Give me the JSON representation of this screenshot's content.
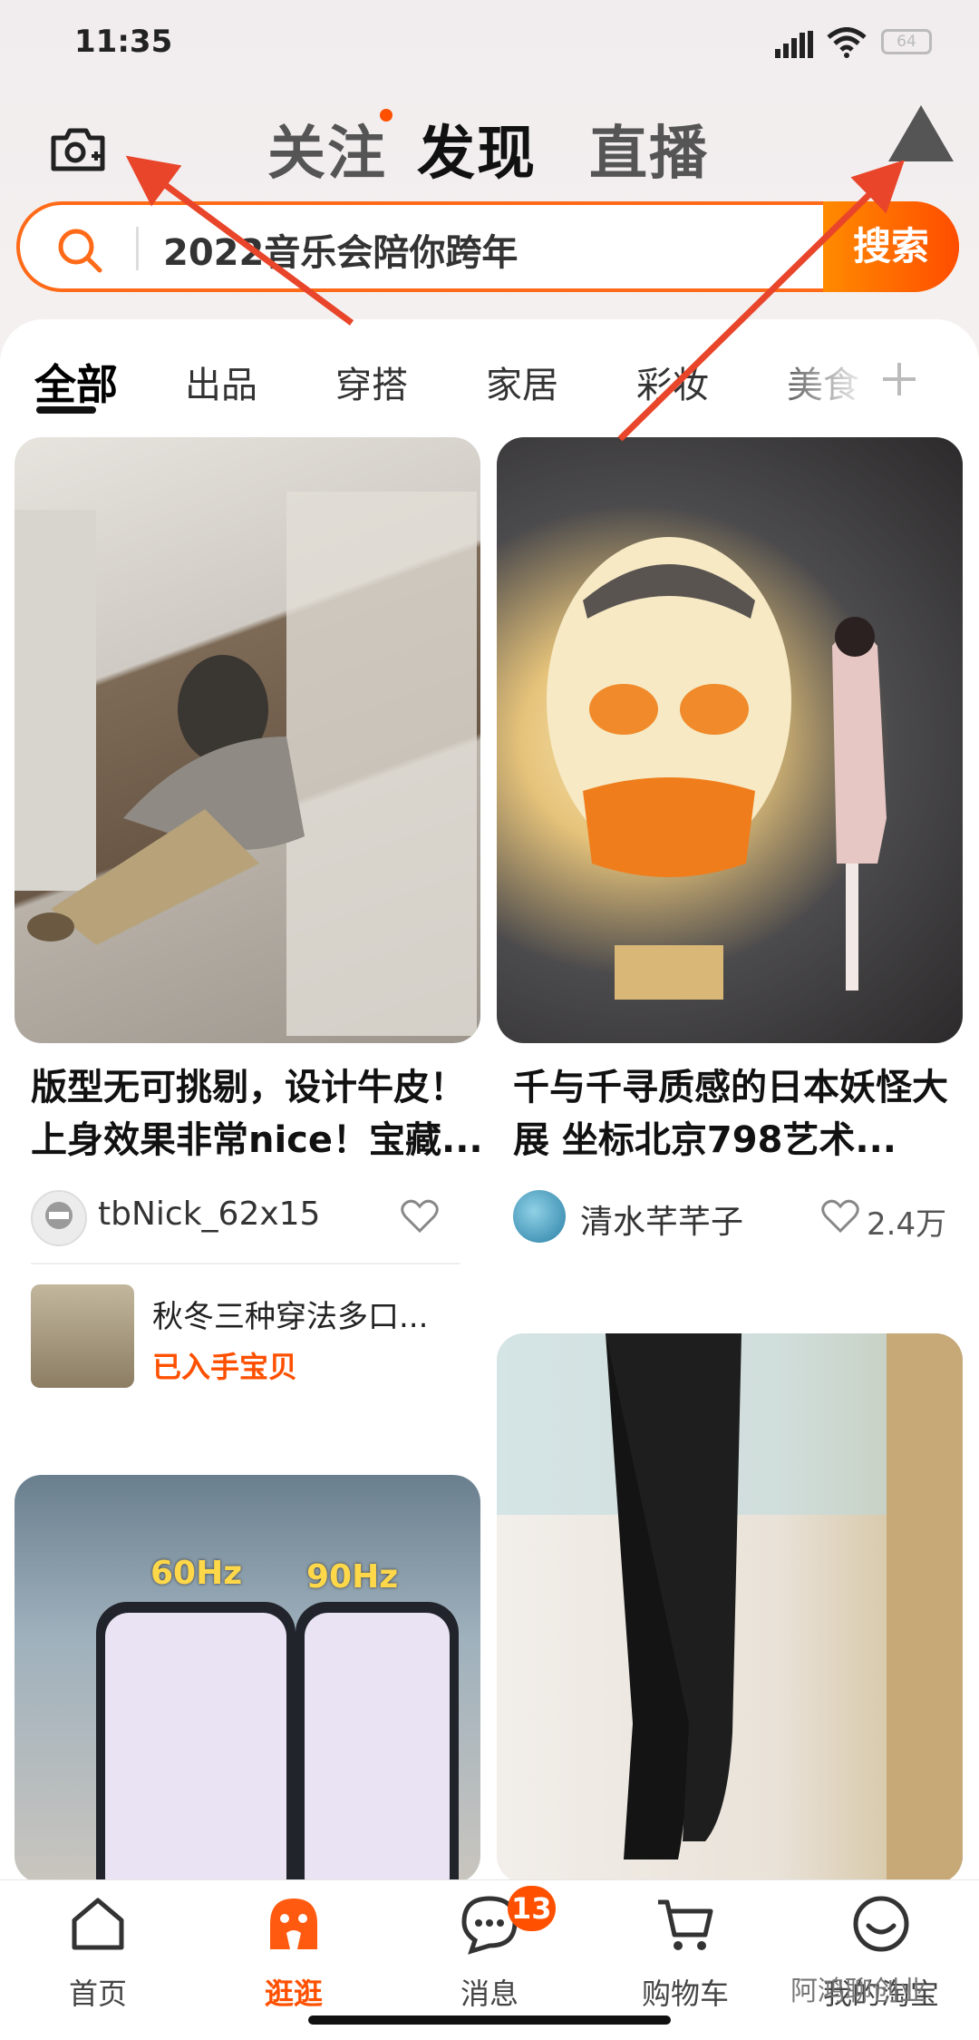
{
  "status_bar": {
    "time": "11:35",
    "battery": "64"
  },
  "header": {
    "tabs": [
      {
        "label": "关注"
      },
      {
        "label": "发现"
      },
      {
        "label": "直播"
      }
    ]
  },
  "search": {
    "placeholder": "2022音乐会陪你跨年",
    "button_label": "搜索"
  },
  "categories": [
    "全部",
    "出品",
    "穿搭",
    "家居",
    "彩妆",
    "美食"
  ],
  "feed": [
    {
      "title_line1": "版型无可挑剔，设计牛皮！",
      "title_line2": "上身效果非常nice！宝藏...",
      "user": "tbNick_62x15",
      "likes": "",
      "related_title": "秋冬三种穿法多口...",
      "related_badge": "已入手宝贝"
    },
    {
      "title_line1": "千与千寻质感的日本妖怪大",
      "title_line2": "展 坐标北京798艺术...",
      "user": "清水芊芊子",
      "likes": "2.4万"
    },
    {
      "labels": [
        "60Hz",
        "90Hz"
      ]
    }
  ],
  "bottom_nav": [
    {
      "label": "首页"
    },
    {
      "label": "逛逛"
    },
    {
      "label": "消息",
      "badge": "13"
    },
    {
      "label": "购物车"
    },
    {
      "label": "我的淘宝"
    }
  ],
  "watermark": "阿鸿聊创业",
  "colors": {
    "accent": "#ff5000",
    "search_border": "#ff6a18",
    "annotation_arrow": "#e8452a"
  }
}
